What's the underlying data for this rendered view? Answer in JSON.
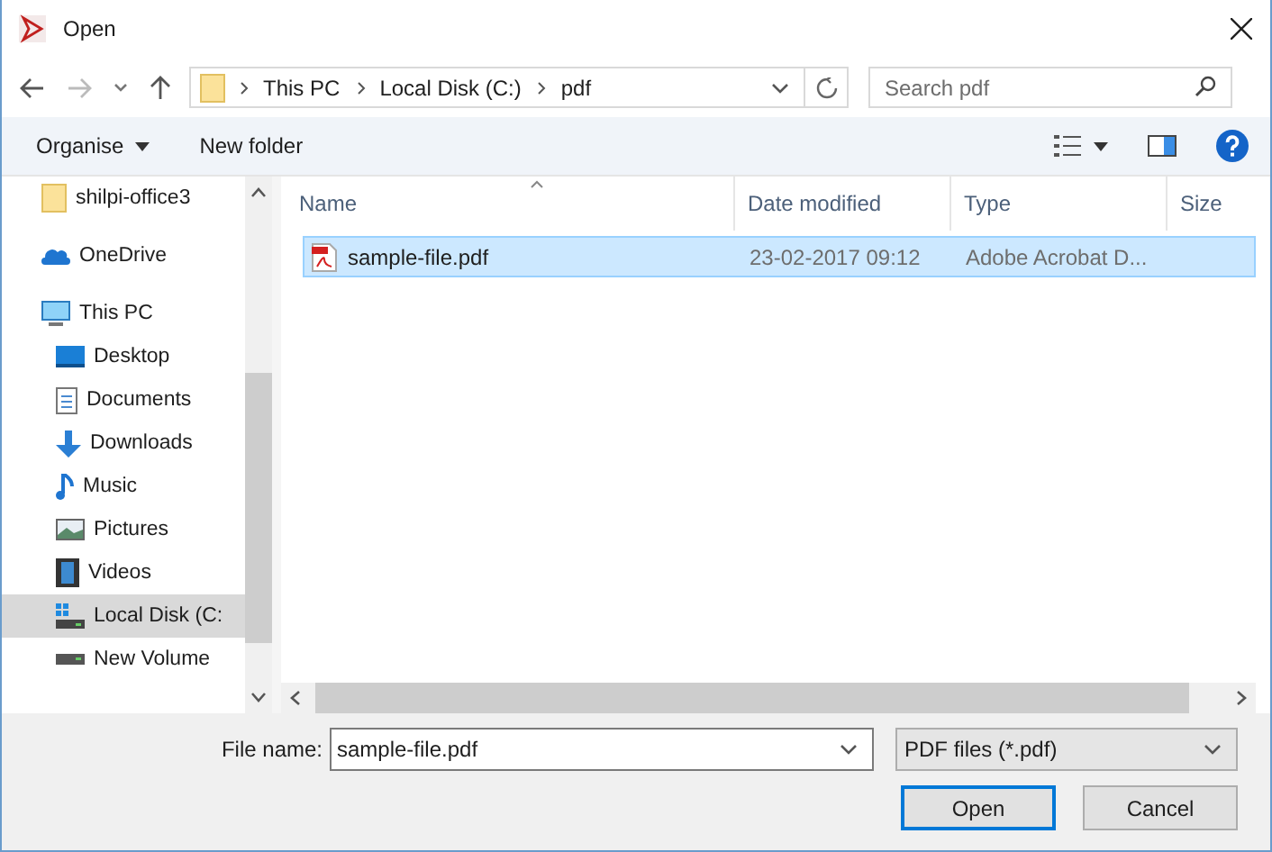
{
  "window": {
    "title": "Open"
  },
  "address": {
    "crumbs": [
      "This PC",
      "Local Disk (C:)",
      "pdf"
    ],
    "search_placeholder": "Search pdf"
  },
  "toolbar": {
    "organise": "Organise",
    "new_folder": "New folder"
  },
  "nav": [
    {
      "label": "shilpi-office3",
      "kind": "folder",
      "selected": false
    },
    {
      "label": "OneDrive",
      "kind": "cloud",
      "selected": false
    },
    {
      "label": "This PC",
      "kind": "pc",
      "selected": false,
      "children": [
        {
          "label": "Desktop",
          "kind": "desktop",
          "selected": false
        },
        {
          "label": "Documents",
          "kind": "documents",
          "selected": false
        },
        {
          "label": "Downloads",
          "kind": "downloads",
          "selected": false
        },
        {
          "label": "Music",
          "kind": "music",
          "selected": false
        },
        {
          "label": "Pictures",
          "kind": "pictures",
          "selected": false
        },
        {
          "label": "Videos",
          "kind": "videos",
          "selected": false
        },
        {
          "label": "Local Disk (C:",
          "kind": "disk",
          "selected": true
        },
        {
          "label": "New Volume",
          "kind": "drive",
          "selected": false
        }
      ]
    }
  ],
  "table": {
    "columns": [
      "Name",
      "Date modified",
      "Type",
      "Size"
    ],
    "rows": [
      {
        "name": "sample-file.pdf",
        "date": "23-02-2017 09:12",
        "type": "Adobe Acrobat D...",
        "selected": true
      }
    ]
  },
  "footer": {
    "file_name_label": "File name:",
    "file_name": "sample-file.pdf",
    "filter": "PDF files (*.pdf)",
    "open": "Open",
    "cancel": "Cancel"
  }
}
